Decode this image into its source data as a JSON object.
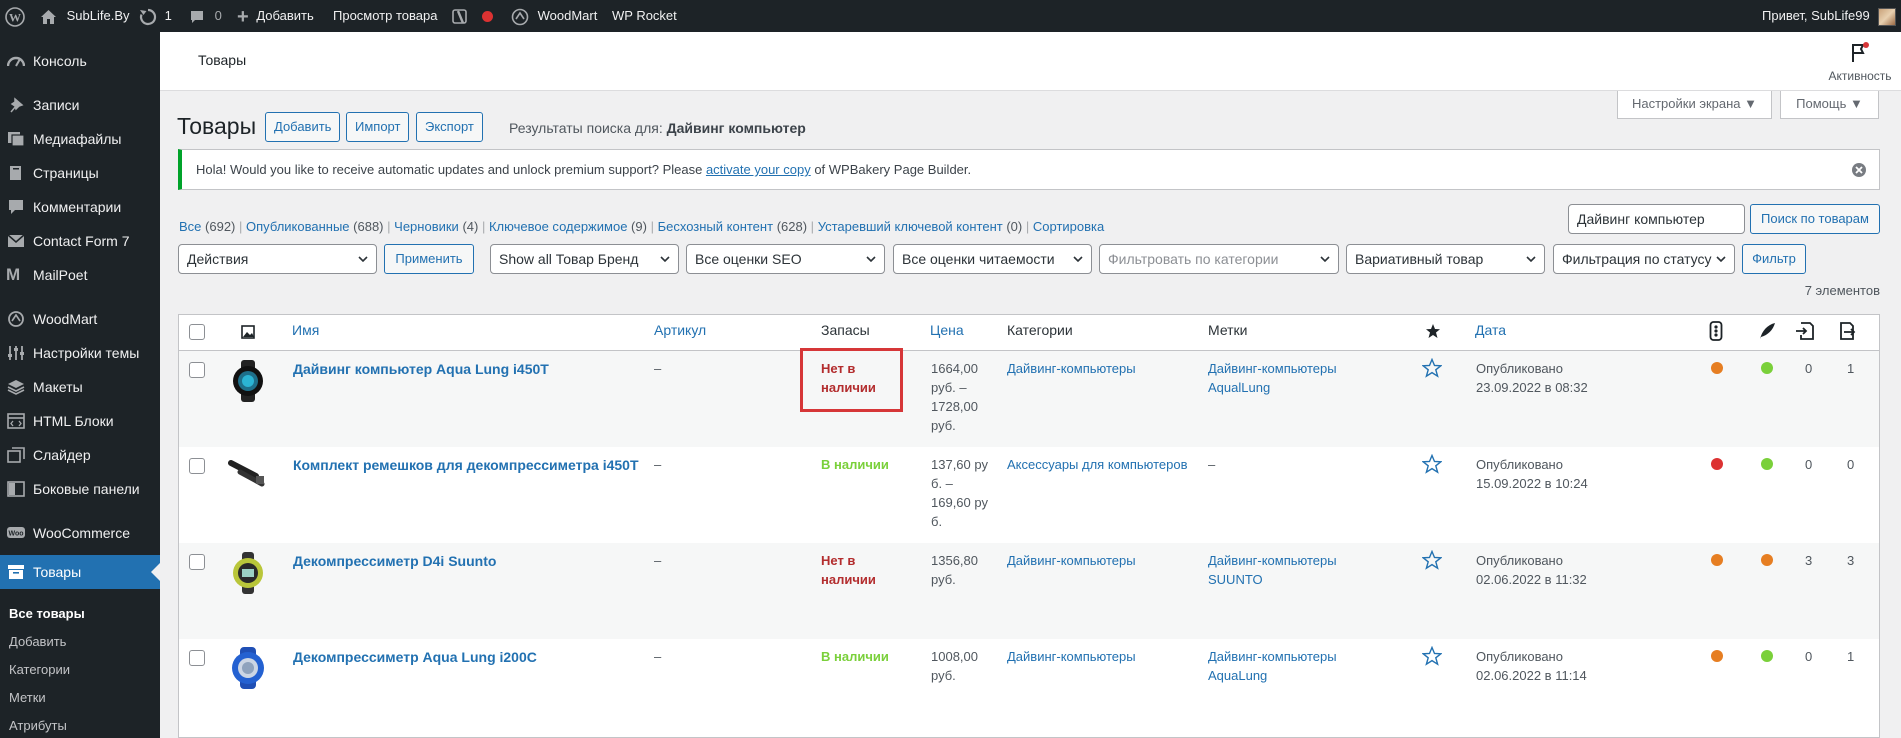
{
  "adminbar": {
    "site": "SubLife.By",
    "updates": "1",
    "comments": "0",
    "add": "Добавить",
    "view": "Просмотр товара",
    "woodmart": "WoodMart",
    "rocket": "WP Rocket",
    "greeting": "Привет, SubLife99"
  },
  "sidebar": {
    "items": [
      "Консоль",
      "Записи",
      "Медиафайлы",
      "Страницы",
      "Комментарии",
      "Contact Form 7",
      "MailPoet",
      "WoodMart",
      "Настройки темы",
      "Макеты",
      "HTML Блоки",
      "Слайдер",
      "Боковые панели",
      "WooCommerce",
      "Товары"
    ],
    "sub": [
      "Все товары",
      "Добавить",
      "Категории",
      "Метки",
      "Атрибуты"
    ]
  },
  "top": {
    "crumb": "Товары",
    "activity": "Активность"
  },
  "screen_options": "Настройки экрана ▼",
  "help": "Помощь ▼",
  "heading": {
    "title": "Товары",
    "add": "Добавить",
    "import": "Импорт",
    "export": "Экспорт",
    "search_prefix": "Результаты поиска для: ",
    "search_term": "Дайвинг компьютер"
  },
  "notice": {
    "pre": "Hola! Would you like to receive automatic updates and unlock premium support? Please ",
    "link": "activate your copy",
    "post": " of WPBakery Page Builder."
  },
  "views": [
    {
      "label": "Все",
      "count": "(692)"
    },
    {
      "label": "Опубликованные",
      "count": "(688)"
    },
    {
      "label": "Черновики",
      "count": "(4)"
    },
    {
      "label": "Ключевое содержимое",
      "count": "(9)"
    },
    {
      "label": "Бесхозный контент",
      "count": "(628)"
    },
    {
      "label": "Устаревший ключевой контент",
      "count": "(0)"
    },
    {
      "label": "Сортировка",
      "count": ""
    }
  ],
  "search": {
    "value": "Дайвинг компьютер",
    "button": "Поиск по товарам"
  },
  "filters": {
    "actions": "Действия",
    "apply": "Применить",
    "brand": "Show all Товар Бренд",
    "seo": "Все оценки SEO",
    "read": "Все оценки читаемости",
    "category": "Фильтровать по категории",
    "type": "Вариативный товар",
    "status": "Фильтрация по статусу",
    "filter": "Фильтр"
  },
  "count": "7 элементов",
  "columns": {
    "name": "Имя",
    "sku": "Артикул",
    "stock": "Запасы",
    "price": "Цена",
    "cats": "Категории",
    "tags": "Метки",
    "date": "Дата"
  },
  "rows": [
    {
      "name": "Дайвинг компьютер Aqua Lung i450T",
      "sku": "–",
      "stock": "Нет в наличии",
      "stock_status": "out",
      "price": [
        "1664,00",
        "руб. –",
        "1728,00",
        "руб."
      ],
      "cats": "Дайвинг-компьютеры",
      "tags": [
        "Дайвинг-компьютеры",
        "AqualLung"
      ],
      "date": [
        "Опубликовано",
        "23.09.2022 в 08:32"
      ],
      "seo": "#e67e22",
      "read": "#7ad03a",
      "links_in": "0",
      "links_out": "1"
    },
    {
      "name": "Комплект ремешков для декомпрессиметра i450T",
      "sku": "–",
      "stock": "В наличии",
      "stock_status": "in",
      "price": [
        "137,60 ру",
        "б. –",
        "169,60 ру",
        "б."
      ],
      "cats": "Аксессуары для компьютеров",
      "tags": [
        "–"
      ],
      "date": [
        "Опубликовано",
        "15.09.2022 в 10:24"
      ],
      "seo": "#dc3232",
      "read": "#7ad03a",
      "links_in": "0",
      "links_out": "0"
    },
    {
      "name": "Декомпрессиметр D4i Suunto",
      "sku": "–",
      "stock": "Нет в наличии",
      "stock_status": "out",
      "price": [
        "1356,80",
        "руб."
      ],
      "cats": "Дайвинг-компьютеры",
      "tags": [
        "Дайвинг-компьютеры",
        "SUUNTO"
      ],
      "date": [
        "Опубликовано",
        "02.06.2022 в 11:32"
      ],
      "seo": "#e67e22",
      "read": "#e67e22",
      "links_in": "3",
      "links_out": "3"
    },
    {
      "name": "Декомпрессиметр Aqua Lung i200C",
      "sku": "–",
      "stock": "В наличии",
      "stock_status": "in",
      "price": [
        "1008,00",
        "руб."
      ],
      "cats": "Дайвинг-компьютеры",
      "tags": [
        "Дайвинг-компьютеры",
        "AquaLung"
      ],
      "date": [
        "Опубликовано",
        "02.06.2022 в 11:14"
      ],
      "seo": "#e67e22",
      "read": "#7ad03a",
      "links_in": "0",
      "links_out": "1"
    }
  ],
  "colors": {
    "accent": "#2271b1",
    "sidebar": "#1d2327",
    "highlight": "#d63638"
  }
}
